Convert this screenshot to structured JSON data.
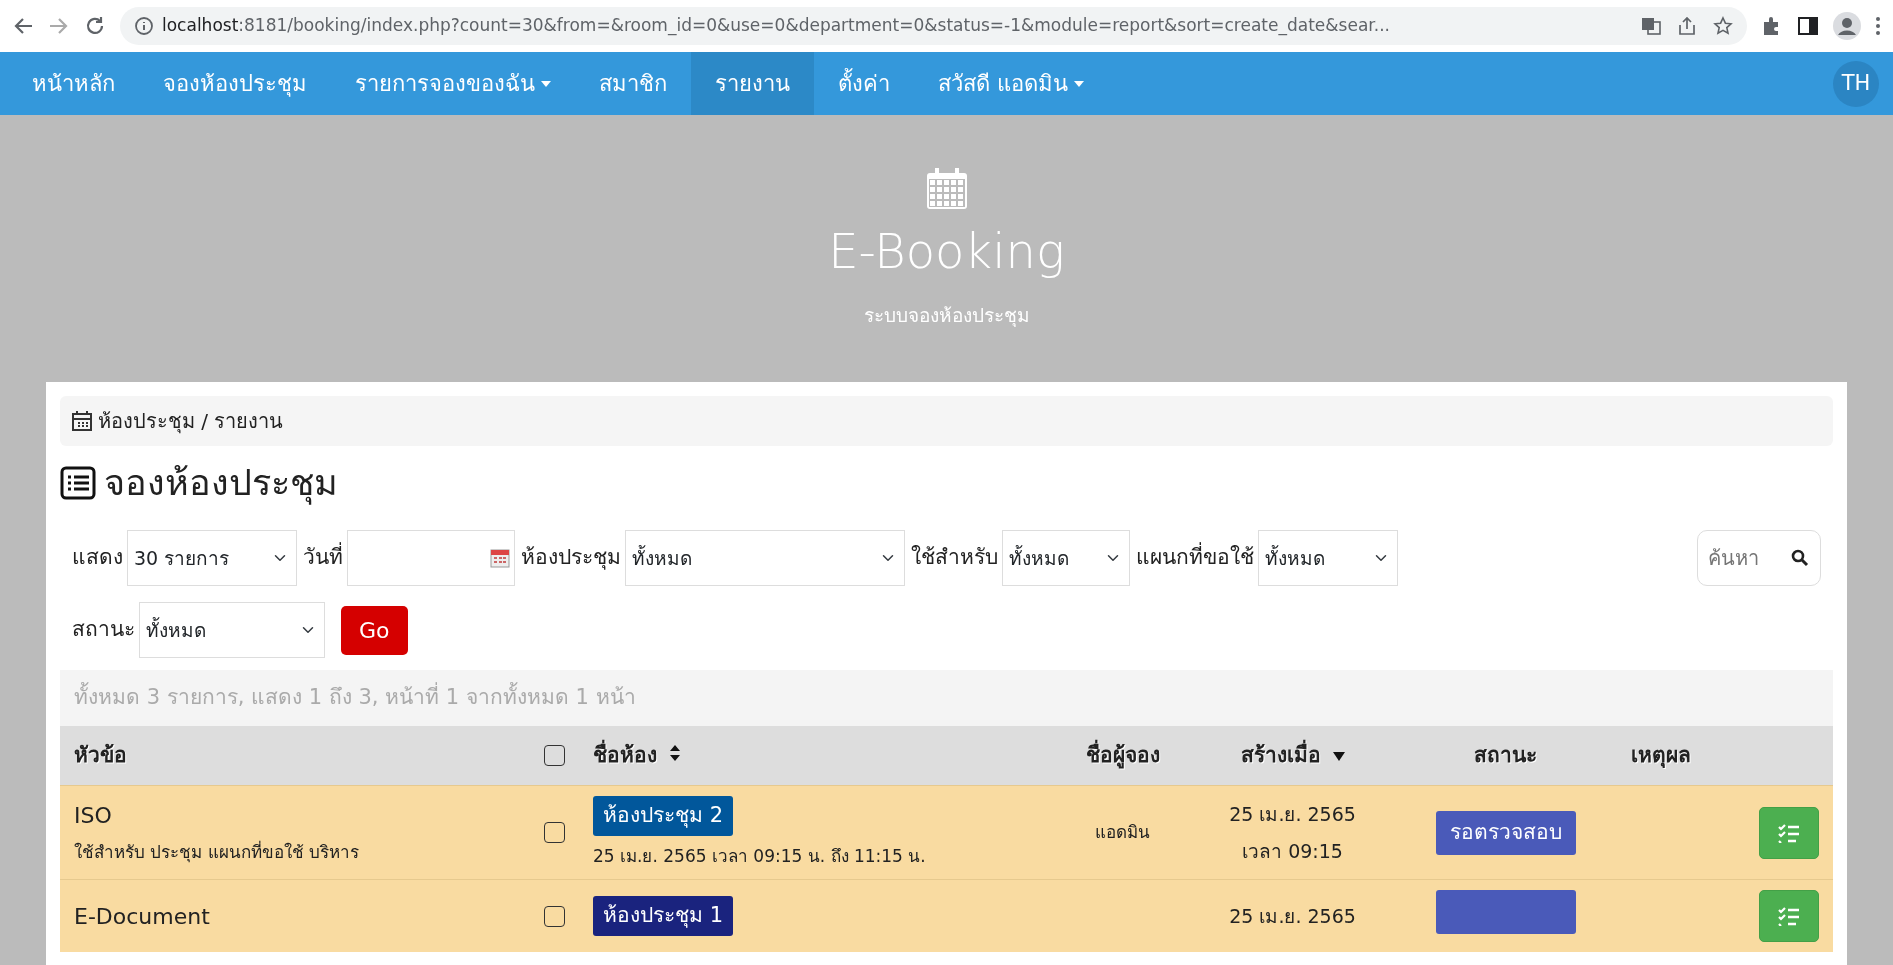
{
  "browser": {
    "url_host": "localhost",
    "url_rest": ":8181/booking/index.php?count=30&from=&room_id=0&use=0&department=0&status=-1&module=report&sort=create_date&sear..."
  },
  "navbar": {
    "items": [
      {
        "label": "หน้าหลัก",
        "dropdown": false,
        "selected": false
      },
      {
        "label": "จองห้องประชุม",
        "dropdown": false,
        "selected": false
      },
      {
        "label": "รายการจองของฉัน",
        "dropdown": true,
        "selected": false
      },
      {
        "label": "สมาชิก",
        "dropdown": false,
        "selected": false
      },
      {
        "label": "รายงาน",
        "dropdown": false,
        "selected": true
      },
      {
        "label": "ตั้งค่า",
        "dropdown": false,
        "selected": false
      },
      {
        "label": "สวัสดี แอดมิน",
        "dropdown": true,
        "selected": false
      }
    ],
    "language": "TH"
  },
  "hero": {
    "title": "E-Booking",
    "subtitle": "ระบบจองห้องประชุม"
  },
  "breadcrumb": "ห้องประชุม / รายงาน",
  "page_title": "จองห้องประชุม",
  "filters": [
    {
      "kind": "select",
      "label": "แสดง",
      "value": "30 รายการ"
    },
    {
      "kind": "date",
      "label": "วันที่"
    },
    {
      "kind": "select",
      "label": "ห้องประชุม",
      "value": "ทั้งหมด"
    },
    {
      "kind": "select",
      "label": "ใช้สำหรับ",
      "value": "ทั้งหมด"
    },
    {
      "kind": "select",
      "label": "แผนกที่ขอใช้",
      "value": "ทั้งหมด"
    },
    {
      "kind": "select",
      "label": "สถานะ",
      "value": "ทั้งหมด"
    }
  ],
  "go_button": "Go",
  "search": {
    "placeholder": "ค้นหา"
  },
  "summary": "ทั้งหมด 3 รายการ, แสดง 1 ถึง 3, หน้าที่ 1 จากทั้งหมด 1 หน้า",
  "table": {
    "columns": [
      {
        "label": "หัวข้อ",
        "kind": "plain"
      },
      {
        "label": "ชื่อห้อง",
        "kind": "sortable"
      },
      {
        "label": "ชื่อผู้จอง",
        "kind": "plain"
      },
      {
        "label": "สร้างเมื่อ",
        "kind": "sorted"
      },
      {
        "label": "สถานะ",
        "kind": "plain"
      },
      {
        "label": "เหตุผล",
        "kind": "plain"
      }
    ],
    "select_all": false,
    "rows": [
      {
        "topic": "ISO",
        "detail": "ใช้สำหรับ ประชุม แผนกที่ขอใช้ บริหาร",
        "checked": false,
        "room": {
          "label": "ห้องประชุม 2",
          "color": "#01579b"
        },
        "time": "25 เม.ย. 2565 เวลา 09:15 น. ถึง 11:15 น.",
        "booker": "แอดมิน",
        "created_date": "25 เม.ย. 2565",
        "created_time": "เวลา 09:15",
        "status": {
          "label": "รอตรวจสอบ",
          "color": "#4a5ab9"
        }
      },
      {
        "topic": "E-Document",
        "checked": false,
        "room": {
          "label": "ห้องประชุม 1",
          "color": "#1a237e"
        },
        "created_date": "25 เม.ย. 2565",
        "status": {
          "color": "#4a5ab9"
        }
      }
    ]
  }
}
